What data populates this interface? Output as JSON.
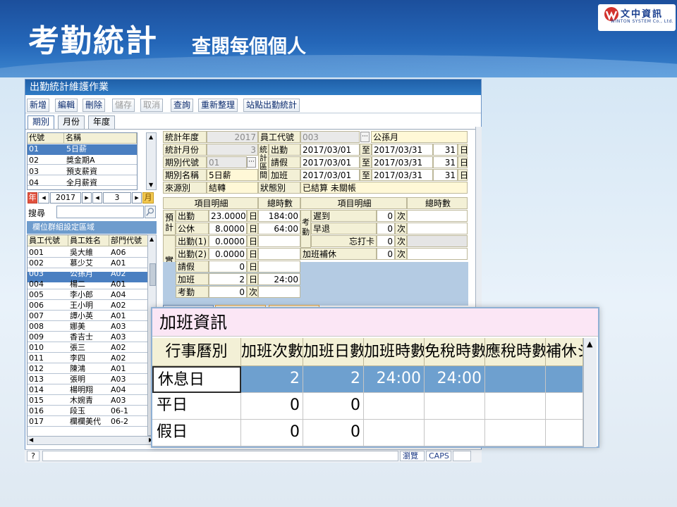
{
  "slide": {
    "title": "考勤統計",
    "subtitle": "查閱每個個人",
    "logo_text": "文中資訊",
    "logo_sub": "WINTON SYSTEM Co., Ltd."
  },
  "window": {
    "title": "出勤統計維護作業"
  },
  "toolbar": {
    "add": "新增",
    "edit": "編輯",
    "delete": "刪除",
    "save": "儲存",
    "cancel": "取消",
    "query": "查詢",
    "reorganize": "重新整理",
    "station_stats": "站點出勤統計"
  },
  "tabs": {
    "period": "期別",
    "month": "月份",
    "year": "年度"
  },
  "period_list": {
    "headers": [
      "代號",
      "名稱"
    ],
    "rows": [
      [
        "01",
        "5日薪"
      ],
      [
        "02",
        "獎金期A"
      ],
      [
        "03",
        "預支薪資"
      ],
      [
        "04",
        "全月薪資"
      ]
    ]
  },
  "year_nav": {
    "year_label": "年",
    "year": "2017",
    "month": "3",
    "month_label": "月"
  },
  "search": {
    "label": "搜尋",
    "value": ""
  },
  "group_area": {
    "label": "欄位群組設定區域"
  },
  "employee_list": {
    "headers": [
      "員工代號",
      "員工姓名",
      "部門代號"
    ],
    "rows": [
      [
        "001",
        "吳大維",
        "A06"
      ],
      [
        "002",
        "慕少艾",
        "A01"
      ],
      [
        "003",
        "公孫月",
        "A02"
      ],
      [
        "004",
        "楊二",
        "A01"
      ],
      [
        "005",
        "李小郎",
        "A04"
      ],
      [
        "006",
        "王小明",
        "A02"
      ],
      [
        "007",
        "譚小英",
        "A01"
      ],
      [
        "008",
        "娜美",
        "A03"
      ],
      [
        "009",
        "香吉士",
        "A03"
      ],
      [
        "010",
        "張三",
        "A02"
      ],
      [
        "011",
        "李四",
        "A02"
      ],
      [
        "012",
        "陳鴻",
        "A01"
      ],
      [
        "013",
        "張明",
        "A03"
      ],
      [
        "014",
        "楊明翔",
        "A04"
      ],
      [
        "015",
        "木婉青",
        "A03"
      ],
      [
        "016",
        "段玉",
        "06-1"
      ],
      [
        "017",
        "欄欄美代",
        "06-2"
      ]
    ]
  },
  "form": {
    "stat_year_label": "統計年度",
    "stat_year": "2017",
    "emp_code_label": "員工代號",
    "emp_code": "003",
    "emp_name": "公孫月",
    "stat_month_label": "統計月份",
    "stat_month": "3",
    "range_group_label": "統計區間",
    "attend_label": "出勤",
    "attend_from": "2017/03/01",
    "attend_to_label": "至",
    "attend_to": "2017/03/31",
    "attend_days": "31",
    "day_unit": "日",
    "period_code_label": "期別代號",
    "period_code": "01",
    "leave_label": "請假",
    "leave_from": "2017/03/01",
    "leave_to": "2017/03/31",
    "leave_days": "31",
    "period_name_label": "期別名稱",
    "period_name": "5日薪",
    "overtime_label": "加班",
    "overtime_from": "2017/03/01",
    "overtime_to": "2017/03/31",
    "overtime_days": "31",
    "source_label": "來源別",
    "source": "結轉",
    "status_label": "狀態別",
    "status": "已結算 未關帳"
  },
  "detail": {
    "item_header": "項目明細",
    "total_hours_header": "總時數",
    "estimated_label": "預計",
    "actual_label": "實際",
    "attendance_group_label": "考勤",
    "left_rows": [
      {
        "name": "出勤",
        "value": "23.0000",
        "unit": "日",
        "hours": "184:00"
      },
      {
        "name": "公休",
        "value": "8.0000",
        "unit": "日",
        "hours": "64:00"
      },
      {
        "name": "出勤(1)",
        "value": "0.0000",
        "unit": "日",
        "hours": ""
      },
      {
        "name": "出勤(2)",
        "value": "0.0000",
        "unit": "日",
        "hours": ""
      },
      {
        "name": "請假",
        "value": "0",
        "unit": "日",
        "hours": ""
      },
      {
        "name": "加班",
        "value": "2",
        "unit": "日",
        "hours": "24:00"
      },
      {
        "name": "考勤",
        "value": "0",
        "unit": "次",
        "hours": ""
      }
    ],
    "right_rows": [
      {
        "name": "遲到",
        "value": "0",
        "unit": "次"
      },
      {
        "name": "早退",
        "value": "0",
        "unit": "次"
      },
      {
        "name": "忘打卡",
        "value": "0",
        "unit": "次"
      },
      {
        "name": "加班補休",
        "value": "0",
        "unit": "次"
      }
    ]
  },
  "statusbar": {
    "browse": "瀏覽",
    "caps": "CAPS"
  },
  "overtime_panel": {
    "title": "加班資訊",
    "headers": [
      "行事曆別",
      "加班次數",
      "加班日數",
      "加班時數",
      "免稅時數",
      "應稅時數",
      "補休ジ"
    ],
    "rows": [
      [
        "休息日",
        "2",
        "2",
        "24:00",
        "24:00",
        "",
        ""
      ],
      [
        "平日",
        "0",
        "0",
        "",
        "",
        "",
        ""
      ],
      [
        "假日",
        "0",
        "0",
        "",
        "",
        "",
        ""
      ]
    ]
  }
}
